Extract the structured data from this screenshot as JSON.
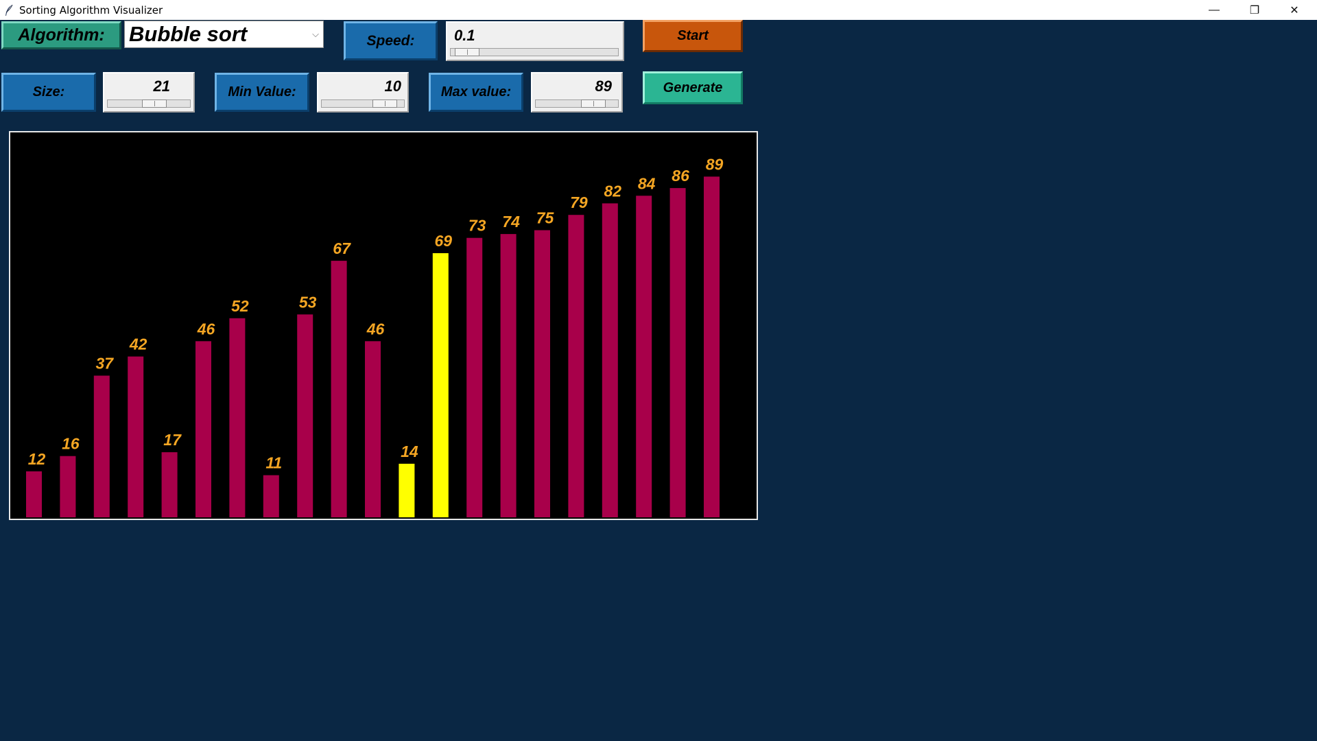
{
  "window": {
    "title": "Sorting Algorithm Visualizer",
    "minimize_glyph": "—",
    "restore_glyph": "❐",
    "close_glyph": "✕"
  },
  "controls": {
    "algorithm_label": "Algorithm:",
    "algorithm_value": "Bubble sort",
    "dropdown_glyph": "⌵",
    "speed_label": "Speed:",
    "speed_value": "0.1",
    "start_label": "Start",
    "size_label": "Size:",
    "size_value": "21",
    "min_label": "Min Value:",
    "min_value": "10",
    "max_label": "Max value:",
    "max_value": "89",
    "generate_label": "Generate"
  },
  "sliders": {
    "speed_fraction": 0.03,
    "size_fraction": 0.6,
    "min_fraction": 0.88,
    "max_fraction": 0.78
  },
  "colors": {
    "background": "#0a2744",
    "bar_default": "#a8004a",
    "bar_highlight": "#ffff00",
    "label": "#f5a623"
  },
  "chart_data": {
    "type": "bar",
    "values": [
      12,
      16,
      37,
      42,
      17,
      46,
      52,
      11,
      53,
      67,
      46,
      14,
      69,
      73,
      74,
      75,
      79,
      82,
      84,
      86,
      89
    ],
    "highlighted_indices": [
      11,
      12
    ],
    "ylim": [
      0,
      100
    ]
  }
}
